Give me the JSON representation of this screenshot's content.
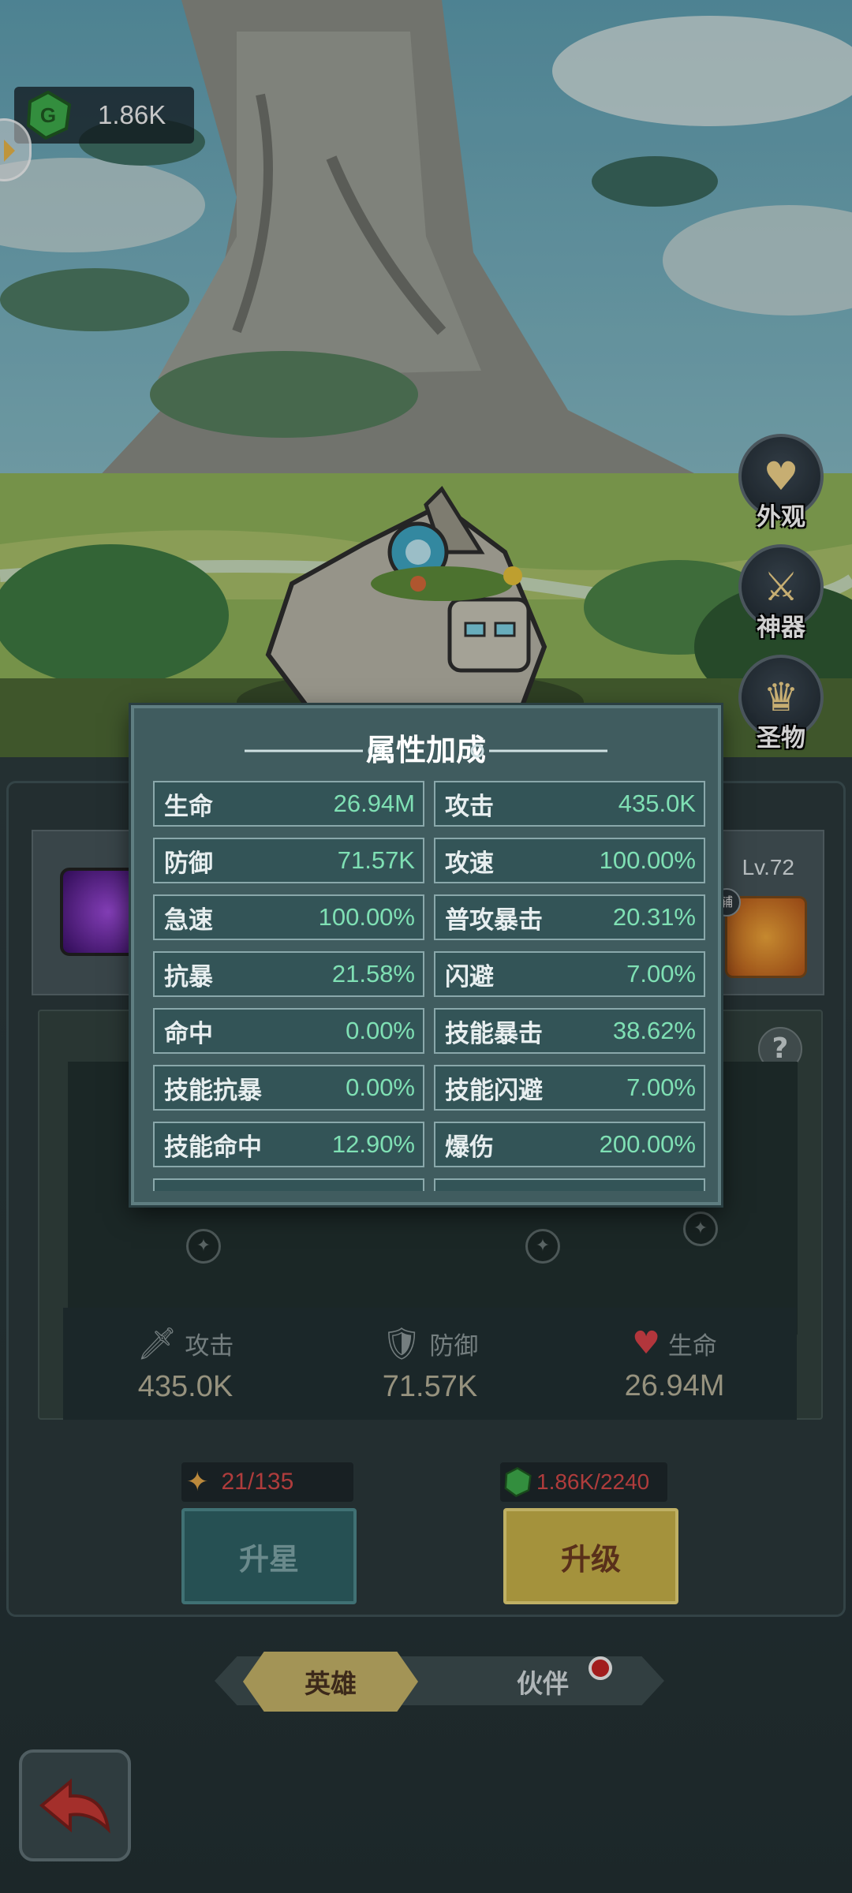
{
  "currency": {
    "icon": "green-gem-icon",
    "amount": "1.86K"
  },
  "side_menu": [
    {
      "label": "外观",
      "icon": "shirt-icon"
    },
    {
      "label": "神器",
      "icon": "spear-icon"
    },
    {
      "label": "圣物",
      "icon": "crown-icon"
    }
  ],
  "hero": {
    "level": "Lv.72",
    "aux_badge": "辅"
  },
  "popup": {
    "title": "属性加成",
    "stats": [
      {
        "k": "生命",
        "v": "26.94M"
      },
      {
        "k": "攻击",
        "v": "435.0K"
      },
      {
        "k": "防御",
        "v": "71.57K"
      },
      {
        "k": "攻速",
        "v": "100.00%"
      },
      {
        "k": "急速",
        "v": "100.00%"
      },
      {
        "k": "普攻暴击",
        "v": "20.31%"
      },
      {
        "k": "抗暴",
        "v": "21.58%"
      },
      {
        "k": "闪避",
        "v": "7.00%"
      },
      {
        "k": "命中",
        "v": "0.00%"
      },
      {
        "k": "技能暴击",
        "v": "38.62%"
      },
      {
        "k": "技能抗暴",
        "v": "0.00%"
      },
      {
        "k": "技能闪避",
        "v": "7.00%"
      },
      {
        "k": "技能命中",
        "v": "12.90%"
      },
      {
        "k": "爆伤",
        "v": "200.00%"
      }
    ]
  },
  "help_label": "?",
  "summary": [
    {
      "label": "攻击",
      "value": "435.0K",
      "icon": "sword-icon"
    },
    {
      "label": "防御",
      "value": "71.57K",
      "icon": "shield-icon"
    },
    {
      "label": "生命",
      "value": "26.94M",
      "icon": "heart-icon"
    }
  ],
  "star_up": {
    "cost": "21/135",
    "label": "升星",
    "icon": "star-icon"
  },
  "level_up": {
    "cost": "1.86K/2240",
    "label": "升级",
    "icon": "green-gem-icon"
  },
  "tabs": {
    "hero": "英雄",
    "partner": "伙伴"
  },
  "colors": {
    "stat_value": "#7fe0b4",
    "cost_red": "#d64a4a",
    "upgrade_gold": "#c8b24a",
    "star_teal": "#2f6266"
  }
}
